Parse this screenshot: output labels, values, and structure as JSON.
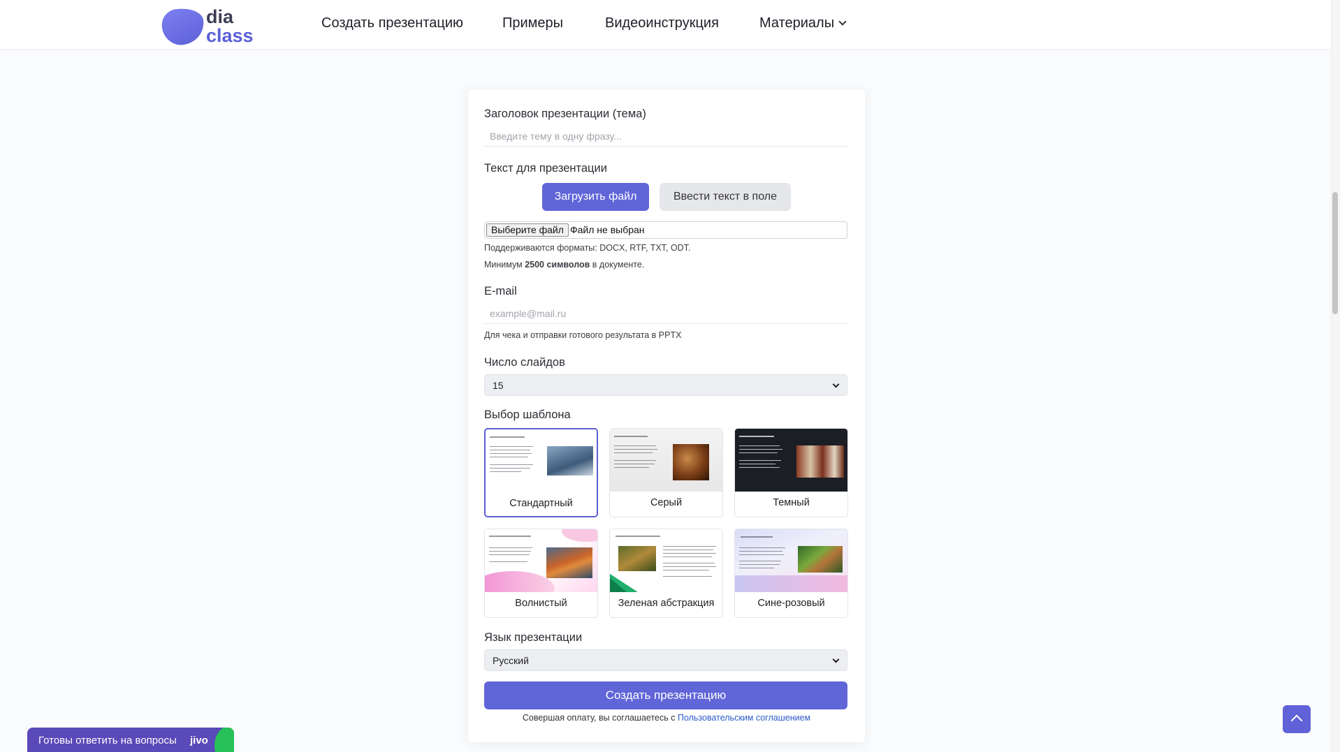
{
  "header": {
    "logo_line1": "dia",
    "logo_line2": "class",
    "nav": [
      {
        "label": "Создать презентацию"
      },
      {
        "label": "Примеры"
      },
      {
        "label": "Видеоинструкция"
      },
      {
        "label": "Материалы"
      }
    ]
  },
  "form": {
    "title_label": "Заголовок презентации (тема)",
    "title_placeholder": "Введите тему в одну фразу...",
    "text_label": "Текст для презентации",
    "upload_button": "Загрузить файл",
    "enter_text_button": "Ввести текст в поле",
    "file_choose_button": "Выберите файл",
    "file_status": "Файл не выбран",
    "formats_hint": "Поддерживаются форматы: DOCX, RTF, TXT, ODT.",
    "min_hint_prefix": "Минимум ",
    "min_hint_bold": "2500 символов",
    "min_hint_suffix": " в документе.",
    "email_label": "E-mail",
    "email_placeholder": "example@mail.ru",
    "email_hint": "Для чека и отправки готового результата в PPTX",
    "slides_label": "Число слайдов",
    "slides_value": "15",
    "template_label": "Выбор шаблона",
    "templates": [
      {
        "name": "Стандартный",
        "selected": true
      },
      {
        "name": "Серый",
        "selected": false
      },
      {
        "name": "Темный",
        "selected": false
      },
      {
        "name": "Волнистый",
        "selected": false
      },
      {
        "name": "Зеленая абстракция",
        "selected": false
      },
      {
        "name": "Сине-розовый",
        "selected": false
      }
    ],
    "language_label": "Язык презентации",
    "language_value": "Русский",
    "submit_button": "Создать презентацию",
    "agreement_prefix": "Совершая оплату, вы соглашаетесь с ",
    "agreement_link": "Пользовательским соглашением"
  },
  "chat_widget": {
    "text": "Готовы ответить на вопросы",
    "brand": "jivo"
  },
  "icons": {
    "scroll_top": "chevron-up-icon",
    "dropdown": "chevron-down-icon"
  },
  "colors": {
    "accent": "#6065d8",
    "chat": "#5a49b8",
    "chat_green": "#27c15a",
    "link": "#2c5bc9"
  }
}
